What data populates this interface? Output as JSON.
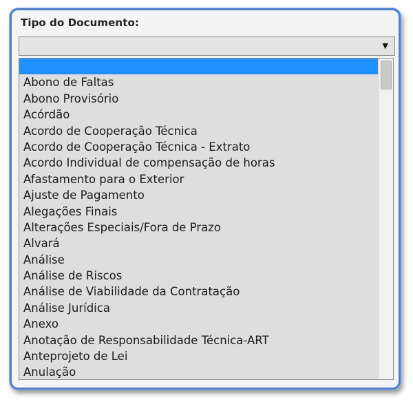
{
  "field": {
    "label": "Tipo do Documento:",
    "selected_value": "",
    "arrow_icon": "dropdown-arrow-icon",
    "arrow_glyph": "▼"
  },
  "dropdown": {
    "options": [
      "",
      "Abono de Faltas",
      "Abono Provisório",
      "Acórdão",
      "Acordo de Cooperação Técnica",
      "Acordo de Cooperação Técnica - Extrato",
      "Acordo Individual de compensação de horas",
      "Afastamento para o Exterior",
      "Ajuste de Pagamento",
      "Alegações Finais",
      "Alterações Especiais/Fora de Prazo",
      "Alvará",
      "Análise",
      "Análise de Riscos",
      "Análise de Viabilidade da Contratação",
      "Análise Jurídica",
      "Anexo",
      "Anotação de Responsabilidade Técnica-ART",
      "Anteprojeto de Lei",
      "Anulação"
    ],
    "highlighted_index": 0
  },
  "colors": {
    "frame_border": "#4f7fcb",
    "highlight": "#1e90ff",
    "list_background": "#dedede"
  }
}
